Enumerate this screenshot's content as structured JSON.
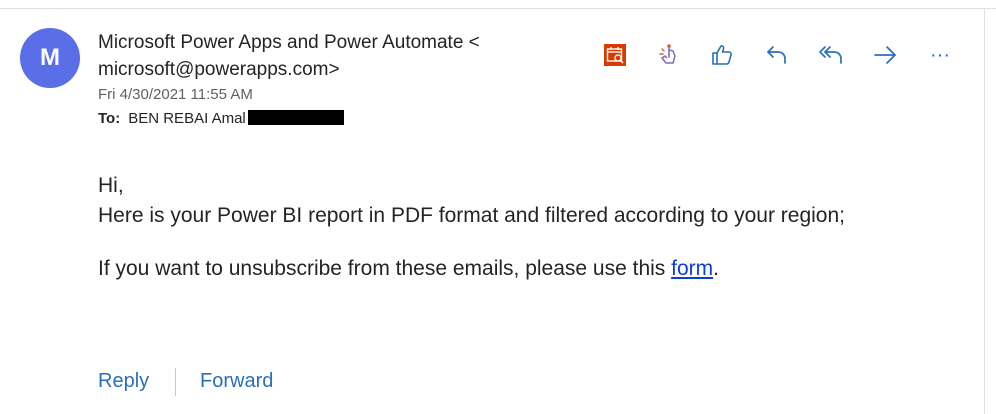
{
  "message": {
    "avatar_initial": "M",
    "sender": "Microsoft Power Apps and Power Automate < microsoft@powerapps.com>",
    "date": "Fri 4/30/2021 11:55 AM",
    "to_label": "To:",
    "to_name": "BEN REBAI Amal",
    "body": {
      "greeting": "Hi,",
      "line1": "Here is your Power BI report in PDF format and filtered according to your region;",
      "line2_prefix": "If you want to unsubscribe from these emails, please use this ",
      "link_text": "form",
      "line2_suffix": "."
    }
  },
  "toolbar": {
    "icons": [
      "calendar-search-icon",
      "touch-icon",
      "like-icon",
      "reply-icon",
      "reply-all-icon",
      "forward-icon",
      "more-icon"
    ],
    "more_label": "···"
  },
  "footer": {
    "reply_label": "Reply",
    "forward_label": "Forward"
  },
  "colors": {
    "avatar": "#5a6ee8",
    "accent": "#2a6fbb",
    "calendar_icon": "#d83b01",
    "link": "#0b3fd4"
  }
}
